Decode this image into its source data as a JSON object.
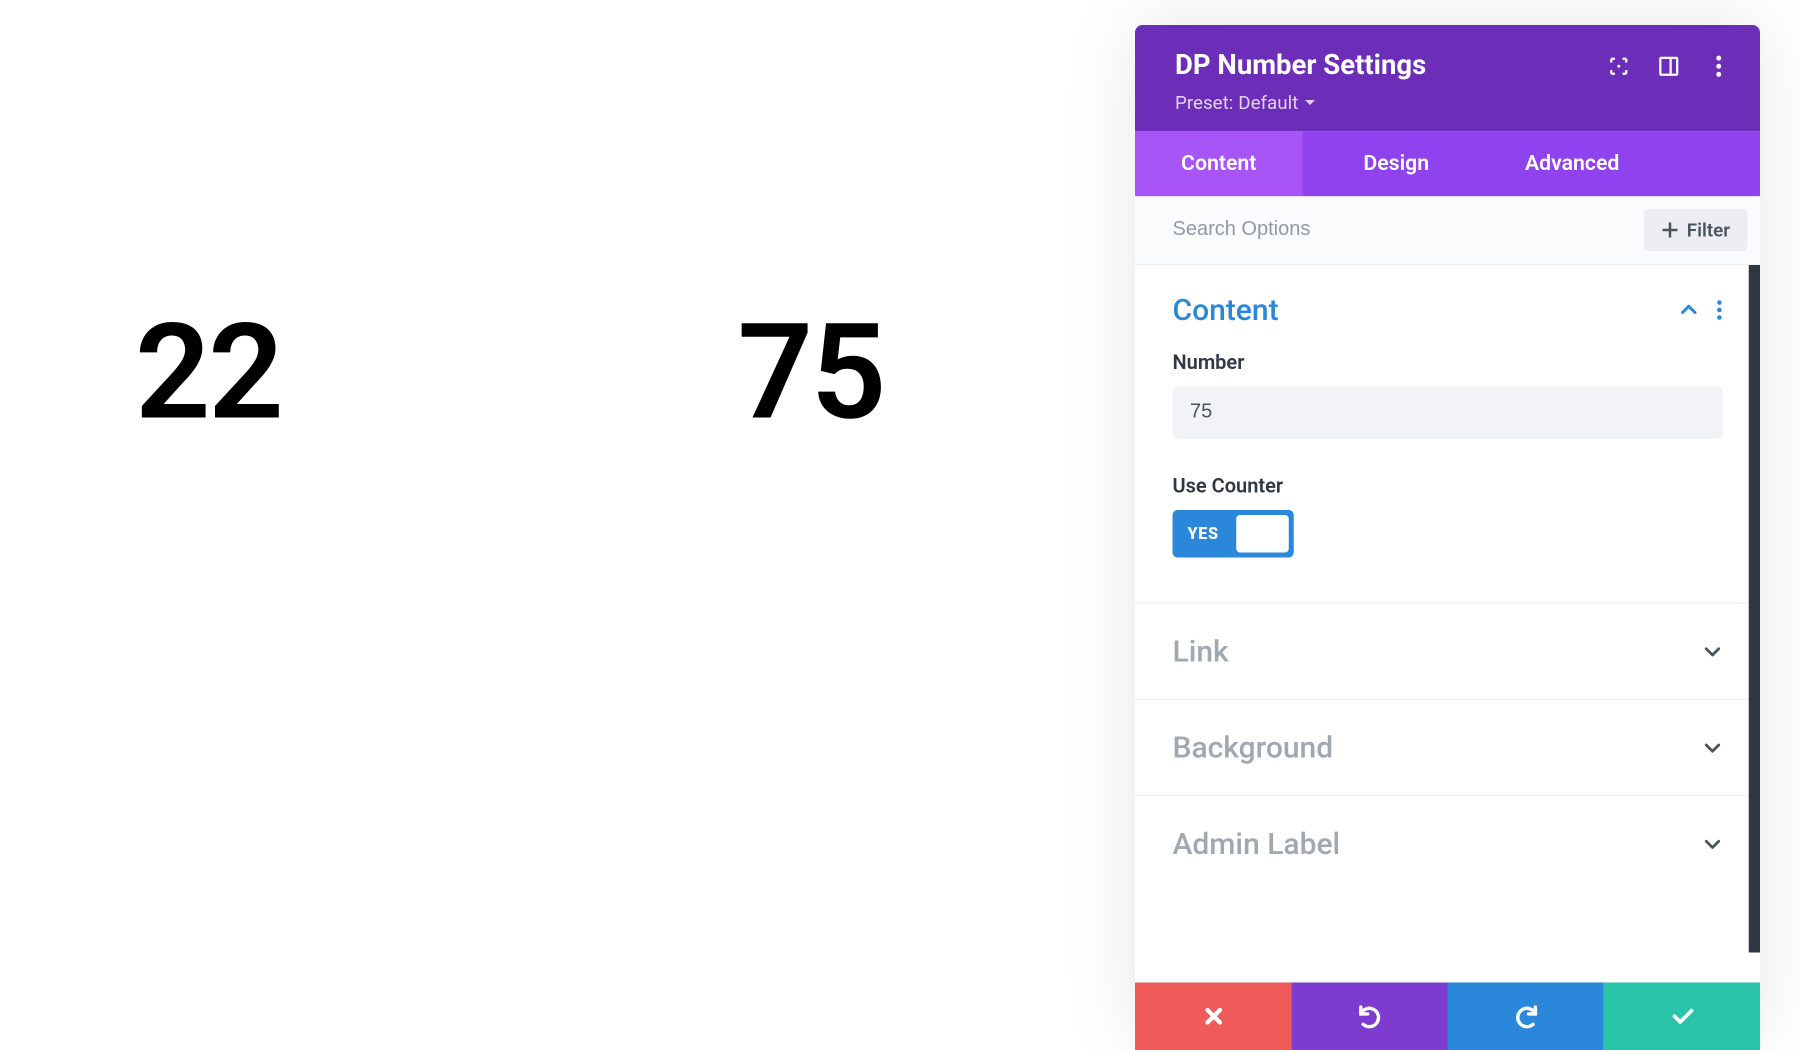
{
  "canvas": {
    "number_left": "22",
    "number_right": "75"
  },
  "panel": {
    "title": "DP Number Settings",
    "preset_prefix": "Preset: ",
    "preset_value": "Default"
  },
  "tabs": {
    "content": "Content",
    "design": "Design",
    "advanced": "Advanced"
  },
  "search": {
    "placeholder": "Search Options",
    "filter_label": "Filter"
  },
  "sections": {
    "content": {
      "title": "Content",
      "number_label": "Number",
      "number_value": "75",
      "use_counter_label": "Use Counter",
      "toggle_value": "YES"
    },
    "link": "Link",
    "background": "Background",
    "admin_label": "Admin Label"
  }
}
